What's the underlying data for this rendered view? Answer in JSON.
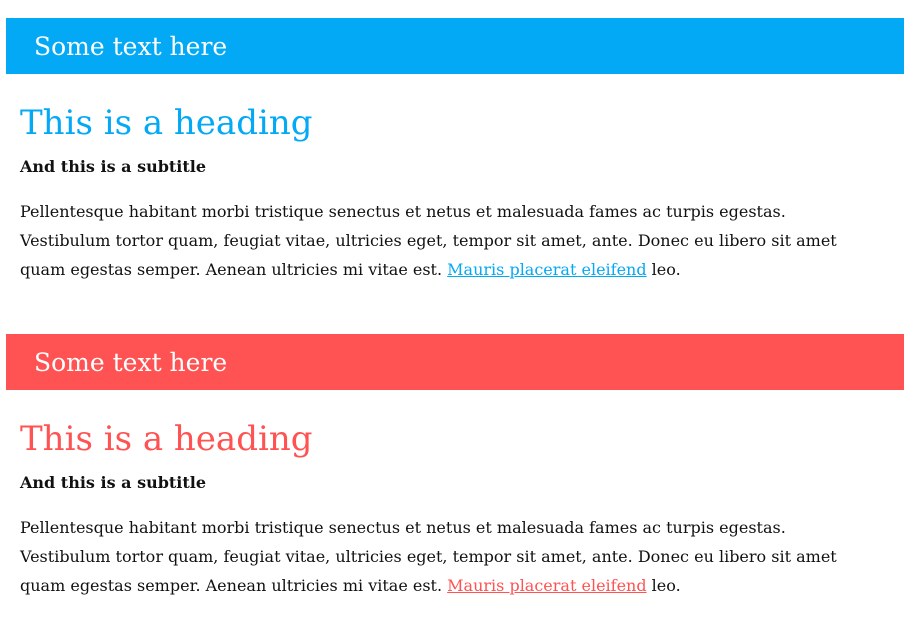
{
  "sections": [
    {
      "banner_text": "Some text here",
      "heading": "This is a heading",
      "subtitle": "And this is a subtitle",
      "paragraph_before_link": "Pellentesque habitant morbi tristique senectus et netus et malesuada fames ac turpis egestas. Vestibulum tortor quam, feugiat vitae, ultricies eget, tempor sit amet, ante. Donec eu libero sit amet quam egestas semper. Aenean ultricies mi vitae est. ",
      "link_text": "Mauris placerat eleifend",
      "paragraph_after_link": " leo.",
      "accent_color": "#03A9F4"
    },
    {
      "banner_text": "Some text here",
      "heading": "This is a heading",
      "subtitle": "And this is a subtitle",
      "paragraph_before_link": "Pellentesque habitant morbi tristique senectus et netus et malesuada fames ac turpis egestas. Vestibulum tortor quam, feugiat vitae, ultricies eget, tempor sit amet, ante. Donec eu libero sit amet quam egestas semper. Aenean ultricies mi vitae est. ",
      "link_text": "Mauris placerat eleifend",
      "paragraph_after_link": " leo.",
      "accent_color": "#FF5252"
    }
  ]
}
